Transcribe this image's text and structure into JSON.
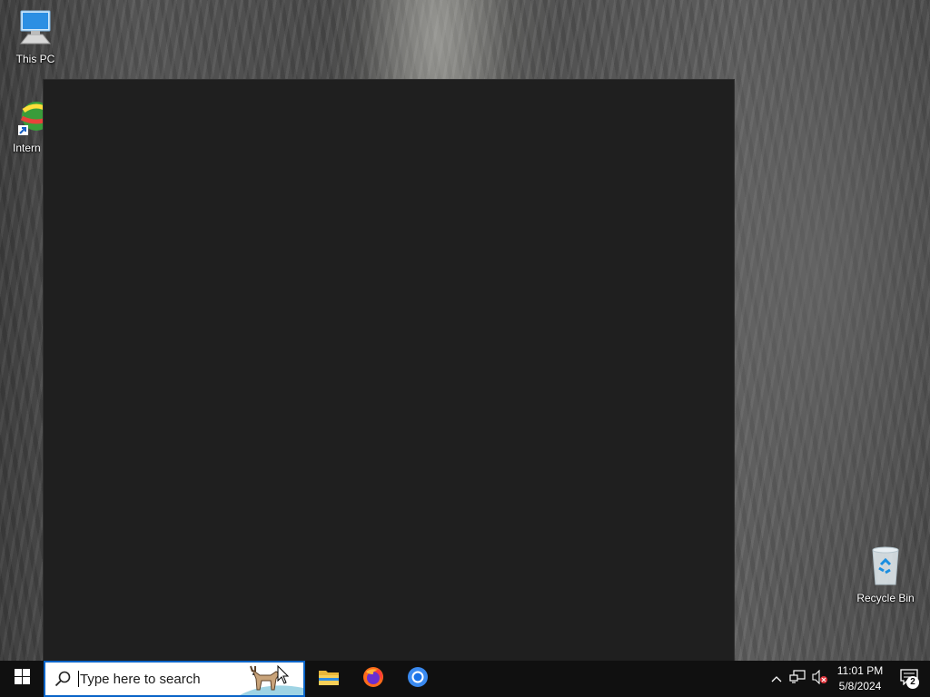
{
  "desktop": {
    "icons": [
      {
        "label": "This PC"
      },
      {
        "label": "Intern Downl"
      },
      {
        "label": "Recycle Bin"
      }
    ]
  },
  "taskbar": {
    "search": {
      "placeholder": "Type here to search"
    },
    "apps": [
      {
        "name": "File Explorer",
        "icon": "folder-icon"
      },
      {
        "name": "Firefox",
        "icon": "firefox-icon"
      },
      {
        "name": "Google Chrome",
        "icon": "chrome-icon"
      }
    ],
    "tray": {
      "time": "11:01 PM",
      "date": "5/8/2024",
      "notification_count": "2"
    }
  },
  "colors": {
    "taskbar_bg": "#101010",
    "window_bg": "#1f1f1f",
    "search_border": "#0a64c8"
  }
}
